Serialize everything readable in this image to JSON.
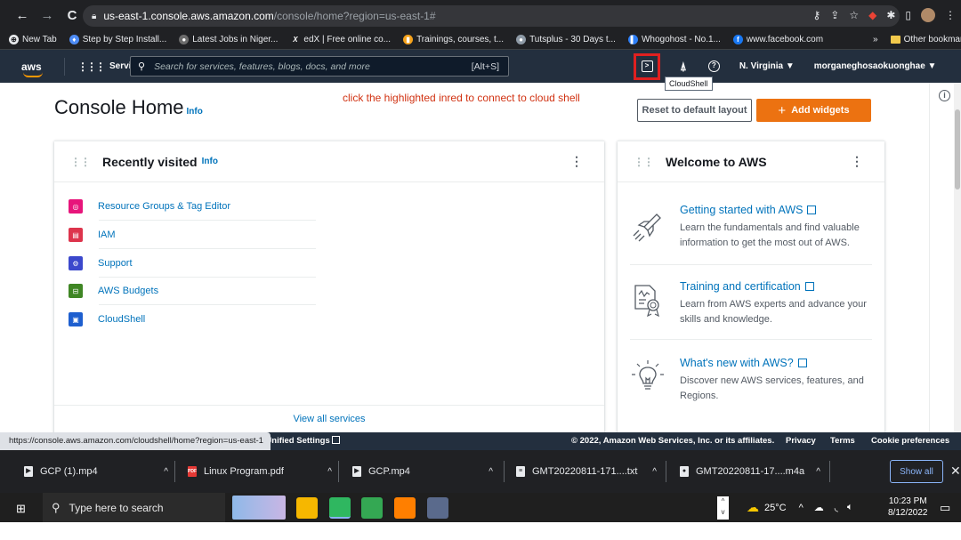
{
  "browser": {
    "url_host": "us-east-1.console.aws.amazon.com",
    "url_path": "/console/home?region=us-east-1#",
    "bookmarks": [
      {
        "label": "New Tab",
        "color": "#e8eaed",
        "glyph": "⊕"
      },
      {
        "label": "Step by Step Install...",
        "color": "#4e8cf5",
        "glyph": "♦"
      },
      {
        "label": "Latest Jobs in Niger...",
        "color": "#3a3a3a",
        "glyph": "●"
      },
      {
        "label": "edX | Free online co...",
        "color": "#202124",
        "glyph": "X"
      },
      {
        "label": "Trainings, courses, t...",
        "color": "#f6a21a",
        "glyph": "▮"
      },
      {
        "label": "Tutsplus - 30 Days t...",
        "color": "#8e9aa6",
        "glyph": "●"
      },
      {
        "label": "Whogohost - No.1...",
        "color": "#2d7ff9",
        "glyph": "▌"
      },
      {
        "label": "www.facebook.com",
        "color": "#1877f2",
        "glyph": "f"
      }
    ],
    "bookmarks_overflow": "»",
    "other_bookmarks": "Other bookmarks"
  },
  "aws_nav": {
    "logo": "aws",
    "services": "Services",
    "search_placeholder": "Search for services, features, blogs, docs, and more",
    "search_shortcut": "[Alt+S]",
    "region": "N. Virginia ▼",
    "account": "morganeghosaokuonghae ▼",
    "cloudshell_tooltip": "CloudShell"
  },
  "annotation_note": "click the highlighted inred  to connect to cloud shell",
  "console": {
    "title": "Console Home",
    "title_info": "Info",
    "reset_button": "Reset to default layout",
    "add_widgets_button": "Add widgets",
    "recently_visited": {
      "title": "Recently visited",
      "info": "Info",
      "items": [
        {
          "label": "Resource Groups & Tag Editor",
          "color": "#e7157b",
          "glyph": "◎"
        },
        {
          "label": "IAM",
          "color": "#dd344c",
          "glyph": "▤"
        },
        {
          "label": "Support",
          "color": "#3b48cc",
          "glyph": "⚙"
        },
        {
          "label": "AWS Budgets",
          "color": "#3f8624",
          "glyph": "⊟"
        },
        {
          "label": "CloudShell",
          "color": "#1e5fcf",
          "glyph": "▣"
        }
      ],
      "view_all": "View all services"
    },
    "welcome": {
      "title": "Welcome to AWS",
      "items": [
        {
          "title": "Getting started with AWS",
          "desc": "Learn the fundamentals and find valuable information to get the most out of AWS.",
          "icon": "rocket-icon"
        },
        {
          "title": "Training and certification",
          "desc": "Learn from AWS experts and advance your skills and knowledge.",
          "icon": "certificate-icon"
        },
        {
          "title": "What's new with AWS?",
          "desc": "Discover new AWS services, features, and Regions.",
          "icon": "lightbulb-icon"
        }
      ]
    }
  },
  "status_url": "https://console.aws.amazon.com/cloudshell/home?region=us-east-1",
  "footer": {
    "unified_settings": "Jnified Settings",
    "copyright": "© 2022, Amazon Web Services, Inc. or its affiliates.",
    "privacy": "Privacy",
    "terms": "Terms",
    "cookies": "Cookie preferences"
  },
  "downloads": {
    "items": [
      {
        "label": "GCP (1).mp4",
        "glyph": "▶"
      },
      {
        "label": "Linux Program.pdf",
        "glyph": "PDF"
      },
      {
        "label": "GCP.mp4",
        "glyph": "▶"
      },
      {
        "label": "GMT20220811-171....txt",
        "glyph": "≡"
      },
      {
        "label": "GMT20220811-17....m4a",
        "glyph": "●"
      }
    ],
    "show_all": "Show all"
  },
  "taskbar": {
    "search_placeholder": "Type here to search",
    "weather": "25°C",
    "time": "10:23 PM",
    "date": "8/12/2022"
  },
  "colors": {
    "aws_nav_bg": "#232f3e",
    "accent_orange": "#ec7211",
    "link_blue": "#0073bb",
    "highlight_red": "#e02020",
    "note_red": "#d13212"
  }
}
